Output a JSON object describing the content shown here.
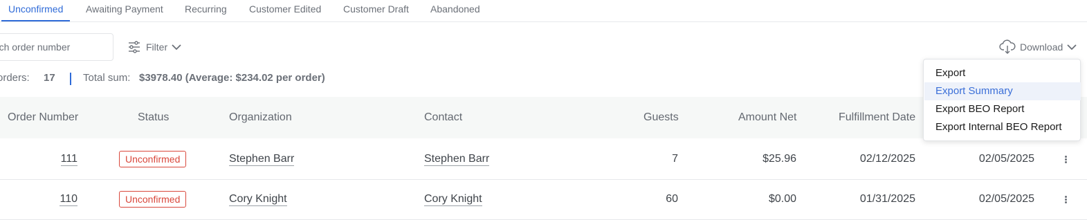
{
  "tabs": [
    {
      "label": "Unconfirmed",
      "active": true
    },
    {
      "label": "Awaiting Payment"
    },
    {
      "label": "Recurring"
    },
    {
      "label": "Customer Edited"
    },
    {
      "label": "Customer Draft"
    },
    {
      "label": "Abandoned"
    }
  ],
  "toolbar": {
    "search_placeholder": "Search order number",
    "filter_label": "Filter",
    "download_label": "Download"
  },
  "summary": {
    "orders_label": "orders:",
    "orders_count": "17",
    "total_label": "Total sum:",
    "total_value": "$3978.40 (Average: $234.02 per order)"
  },
  "table": {
    "headers": [
      "Order Number",
      "Status",
      "Organization",
      "Contact",
      "Guests",
      "Amount Net",
      "Fulfillment Date"
    ],
    "rows": [
      {
        "order": "111",
        "status": "Unconfirmed",
        "organization": "Stephen Barr",
        "contact": "Stephen Barr",
        "guests": "7",
        "amount": "$25.96",
        "fulfillment": "02/12/2025",
        "created": "02/05/2025"
      },
      {
        "order": "110",
        "status": "Unconfirmed",
        "organization": "Cory Knight",
        "contact": "Cory Knight",
        "guests": "60",
        "amount": "$0.00",
        "fulfillment": "01/31/2025",
        "created": "02/05/2025"
      }
    ]
  },
  "download_menu": {
    "items": [
      "Export",
      "Export Summary",
      "Export BEO Report",
      "Export Internal BEO Report"
    ],
    "highlighted": "Export Summary"
  },
  "colors": {
    "accent": "#2f6bd8",
    "status_unconfirmed": "#d9473b",
    "header_bg": "#f6f8f7"
  },
  "icons": [
    "filter-sliders-icon",
    "chevron-down-icon",
    "cloud-download-icon",
    "more-vertical-icon"
  ]
}
